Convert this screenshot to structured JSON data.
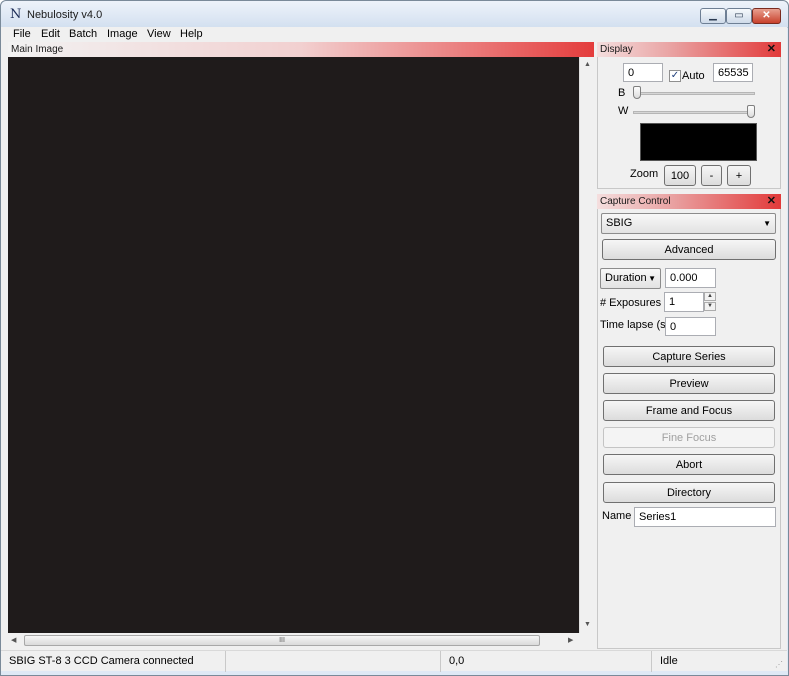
{
  "window": {
    "title": "Nebulosity v4.0",
    "icon": "N",
    "min_glyph": "▁",
    "max_glyph": "▭",
    "close_glyph": "✕"
  },
  "menu": [
    "File",
    "Edit",
    "Batch",
    "Image",
    "View",
    "Help"
  ],
  "panels": {
    "main_image": {
      "title": "Main Image",
      "hscroll_grip": "III"
    },
    "display": {
      "title": "Display",
      "close_glyph": "✕",
      "black_value": "0",
      "auto_checked": true,
      "auto_label": "Auto",
      "white_value": "65535",
      "b_label": "B",
      "w_label": "W",
      "b_slider_level": 0.0,
      "w_slider_level": 1.0,
      "zoom_label": "Zoom",
      "zoom_value": "100",
      "zoom_out_label": "-",
      "zoom_in_label": "+"
    },
    "capture": {
      "title": "Capture Control",
      "close_glyph": "✕",
      "camera": "SBIG",
      "advanced_label": "Advanced",
      "duration_mode": "Duration",
      "duration_value": "0.000",
      "exposures_label": "# Exposures",
      "exposures_value": "1",
      "timelapse_label": "Time lapse (s)",
      "timelapse_value": "0",
      "buttons": {
        "capture_series": "Capture Series",
        "preview": "Preview",
        "frame_focus": "Frame and Focus",
        "fine_focus": "Fine Focus",
        "abort": "Abort",
        "directory": "Directory"
      },
      "name_label": "Name",
      "name_value": "Series1"
    }
  },
  "status": {
    "message": "SBIG ST-8 3 CCD Camera connected",
    "blank": "",
    "coords": "0,0",
    "state": "Idle"
  },
  "colors": {
    "image_bg": "#1f1b1b",
    "header_accent": "#e23a3a"
  }
}
